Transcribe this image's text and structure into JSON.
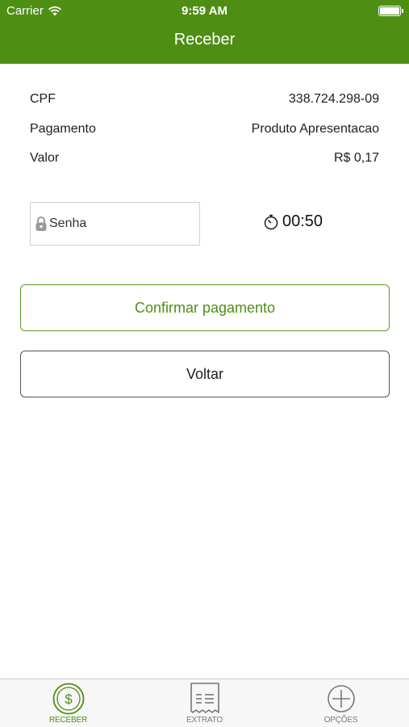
{
  "status_bar": {
    "carrier": "Carrier",
    "time": "9:59 AM"
  },
  "nav": {
    "title": "Receber"
  },
  "info": {
    "rows": [
      {
        "label": "CPF",
        "value": "338.724.298-09"
      },
      {
        "label": "Pagamento",
        "value": "Produto Apresentacao"
      },
      {
        "label": "Valor",
        "value": "R$ 0,17"
      }
    ]
  },
  "password": {
    "placeholder": "Senha",
    "icon": "lock-icon"
  },
  "timer": {
    "value": "00:50",
    "icon": "stopwatch-icon"
  },
  "buttons": {
    "confirm": "Confirmar pagamento",
    "back": "Voltar"
  },
  "tabs": [
    {
      "label": "RECEBER",
      "icon": "dollar-coin-icon",
      "active": true
    },
    {
      "label": "EXTRATO",
      "icon": "receipt-icon",
      "active": false
    },
    {
      "label": "OPÇÕES",
      "icon": "plus-circle-icon",
      "active": false
    }
  ],
  "colors": {
    "brand_green": "#4f8e15",
    "tab_inactive": "#7a7a7a"
  }
}
